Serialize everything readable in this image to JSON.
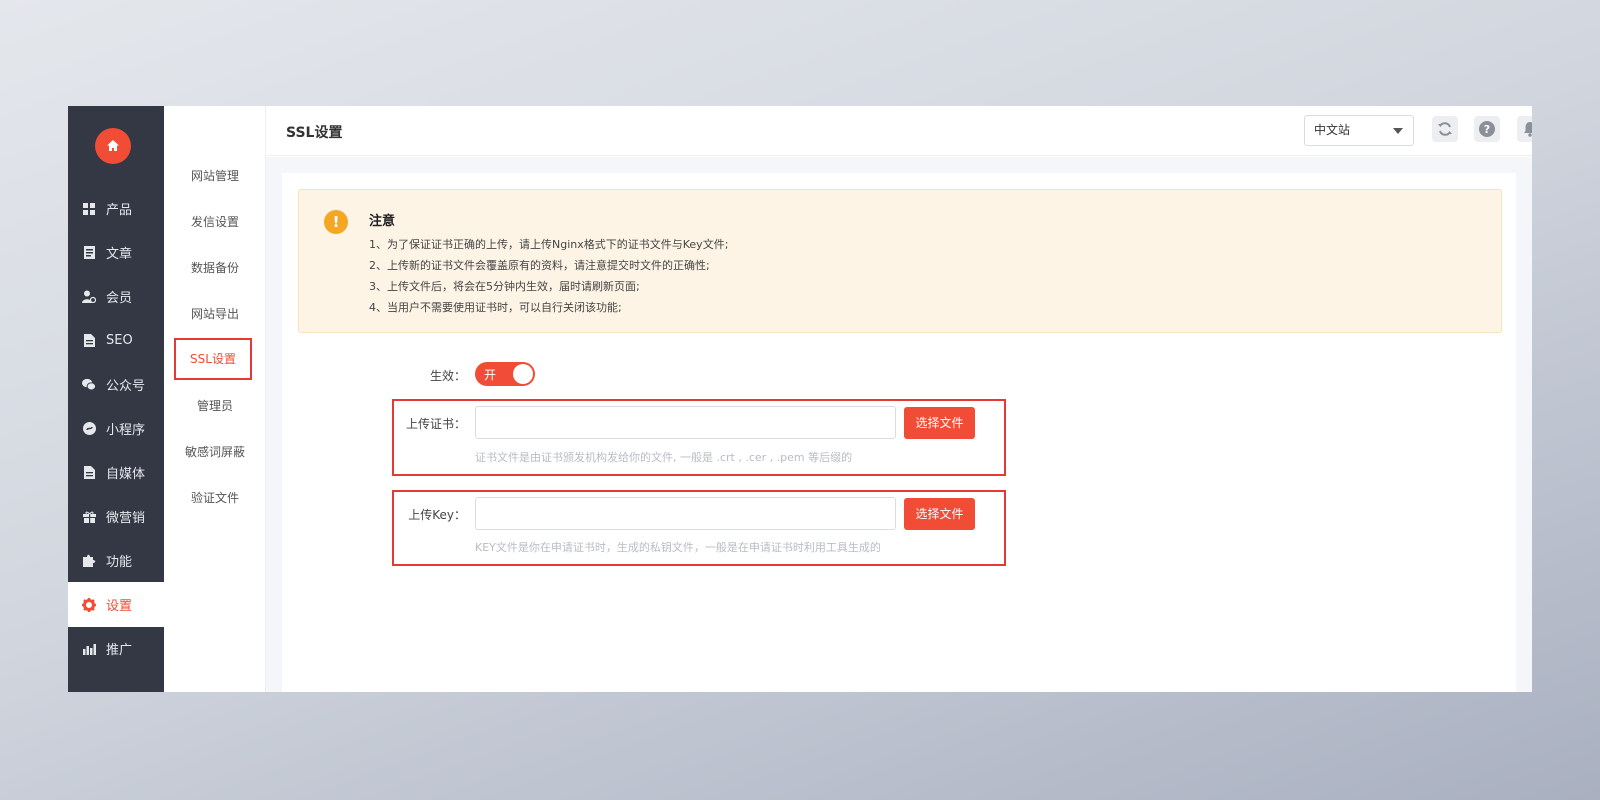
{
  "sidebar": {
    "items": [
      {
        "label": "产品"
      },
      {
        "label": "文章"
      },
      {
        "label": "会员"
      },
      {
        "label": "SEO"
      },
      {
        "label": "公众号"
      },
      {
        "label": "小程序"
      },
      {
        "label": "自媒体"
      },
      {
        "label": "微营销"
      },
      {
        "label": "功能"
      },
      {
        "label": "设置"
      },
      {
        "label": "推广"
      }
    ],
    "active_index": 9
  },
  "subnav": {
    "items": [
      {
        "label": "网站管理"
      },
      {
        "label": "发信设置"
      },
      {
        "label": "数据备份"
      },
      {
        "label": "网站导出"
      },
      {
        "label": "SSL设置"
      },
      {
        "label": "管理员"
      },
      {
        "label": "敏感词屏蔽"
      },
      {
        "label": "验证文件"
      }
    ],
    "active_index": 4
  },
  "header": {
    "title": "SSL设置",
    "site_select": "中文站"
  },
  "notice": {
    "title": "注意",
    "lines": [
      "1、为了保证证书正确的上传，请上传Nginx格式下的证书文件与Key文件;",
      "2、上传新的证书文件会覆盖原有的资料，请注意提交时文件的正确性;",
      "3、上传文件后，将会在5分钟内生效，届时请刷新页面;",
      "4、当用户不需要使用证书时，可以自行关闭该功能;"
    ]
  },
  "form": {
    "enable_label": "生效：",
    "enable_state": "开",
    "cert_label": "上传证书：",
    "cert_button": "选择文件",
    "cert_hint": "证书文件是由证书颁发机构发给你的文件, 一般是 .crt , .cer , .pem 等后缀的",
    "key_label": "上传Key：",
    "key_button": "选择文件",
    "key_hint": "KEY文件是你在申请证书时，生成的私钥文件，一般是在申请证书时利用工具生成的"
  },
  "colors": {
    "accent": "#f04c36",
    "sidebar_bg": "#333844",
    "notice_bg": "#fdf4e6",
    "warning": "#f5a623"
  }
}
